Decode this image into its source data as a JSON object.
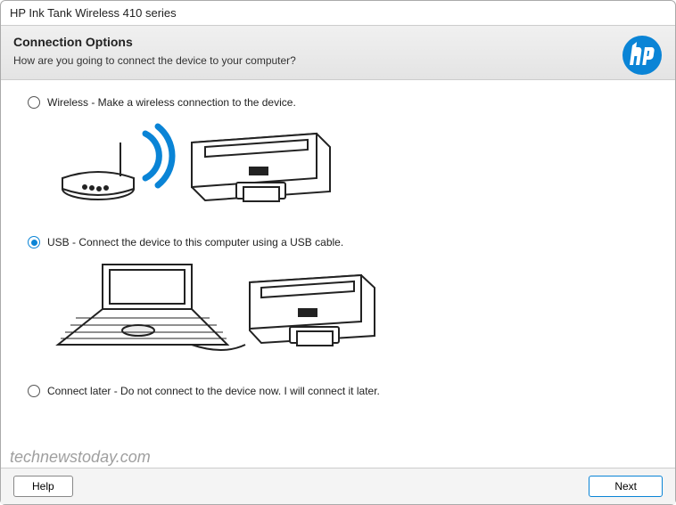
{
  "window": {
    "title": "HP Ink Tank Wireless 410 series"
  },
  "header": {
    "heading": "Connection Options",
    "subtext": "How are you going to connect the device to your computer?"
  },
  "options": {
    "wireless": {
      "label": "Wireless - Make a wireless connection to the device.",
      "selected": false
    },
    "usb": {
      "label": "USB - Connect the device to this computer using a USB cable.",
      "selected": true
    },
    "later": {
      "label": "Connect later - Do not connect to the device now. I will connect it later.",
      "selected": false
    }
  },
  "footer": {
    "help": "Help",
    "next": "Next"
  },
  "watermark": "technewstoday.com",
  "colors": {
    "accent": "#0a84d6"
  }
}
